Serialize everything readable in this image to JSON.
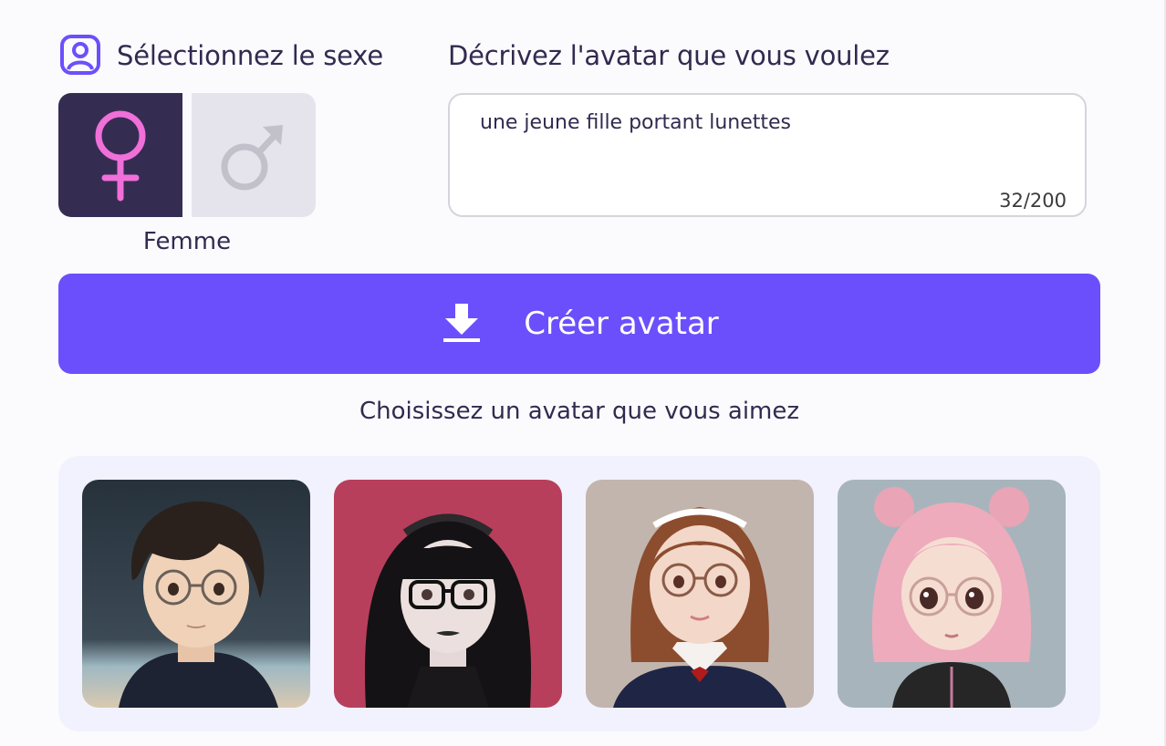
{
  "gender_section": {
    "title": "Sélectionnez le sexe",
    "female_symbol": "♀",
    "male_symbol": "♂",
    "selected_label": "Femme"
  },
  "description_section": {
    "title": "Décrivez l'avatar que vous voulez",
    "value": "une jeune fille portant lunettes",
    "counter": "32/200"
  },
  "create_button": {
    "label": "Créer avatar"
  },
  "gallery": {
    "prompt": "Choisissez un avatar que vous aimez",
    "avatars": [
      "anime-boy-glasses",
      "goth-girl-glasses",
      "victorian-girl-glasses",
      "chibi-pink-hair-glasses"
    ]
  },
  "colors": {
    "accent": "#6c4ffc",
    "selected_bg": "#352d51",
    "female_symbol": "#f06fd9",
    "unselected_bg": "#e5e4ec",
    "text": "#322a4f"
  }
}
